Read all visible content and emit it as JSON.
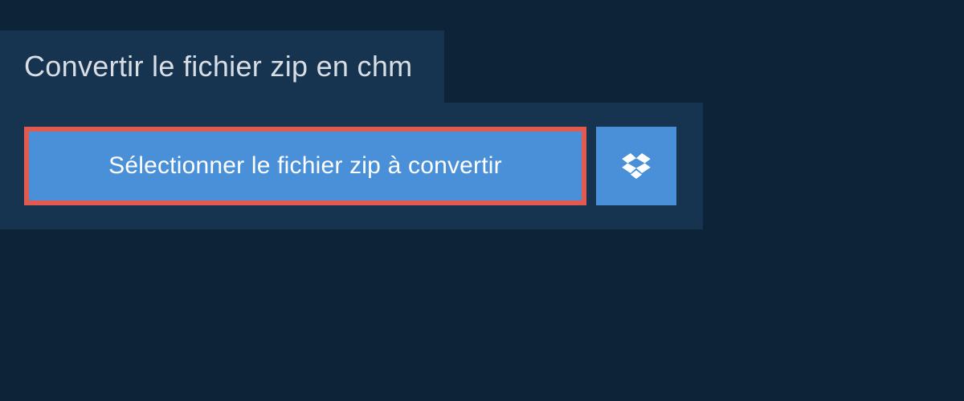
{
  "header": {
    "title": "Convertir le fichier zip en chm"
  },
  "main": {
    "select_button_label": "Sélectionner le fichier zip à convertir"
  },
  "colors": {
    "background": "#0d2438",
    "panel": "#163350",
    "accent": "#4a90d9",
    "highlight_border": "#e05a4f"
  }
}
